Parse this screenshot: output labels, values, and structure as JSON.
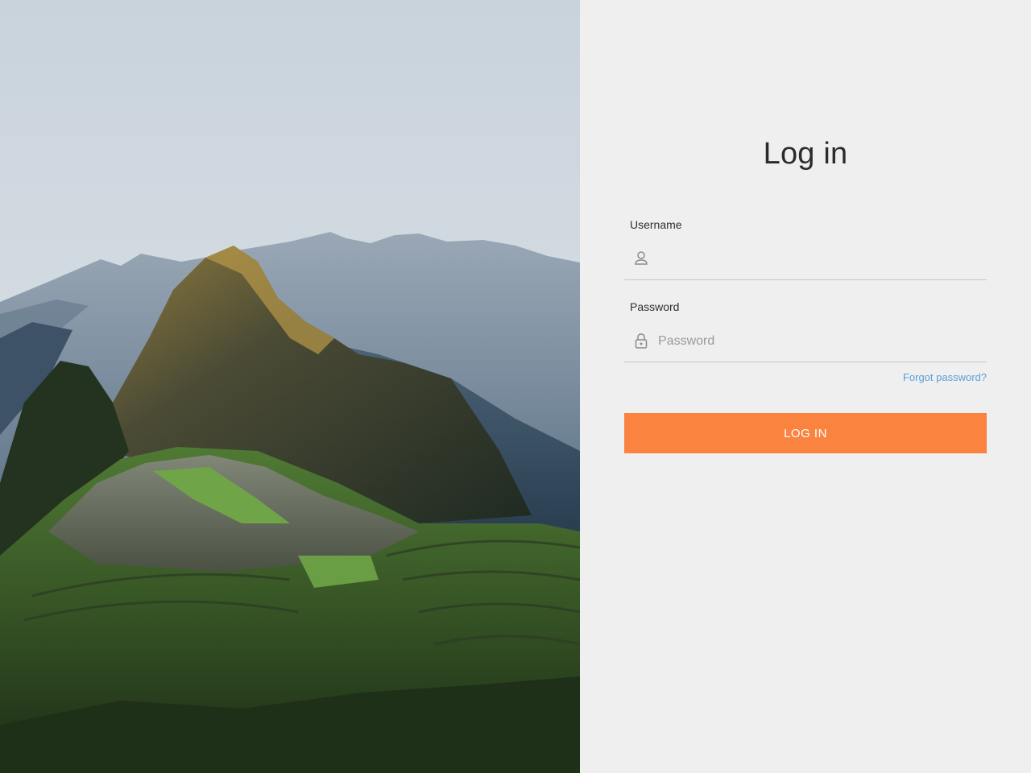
{
  "hero_image": {
    "description_icon": "mountain-landscape-image"
  },
  "login": {
    "title": "Log in",
    "username": {
      "label": "Username",
      "value": "",
      "placeholder": "",
      "icon": "user-icon"
    },
    "password": {
      "label": "Password",
      "value": "",
      "placeholder": "Password",
      "icon": "lock-icon"
    },
    "forgot_password": "Forgot password?",
    "submit_label": "LOG IN"
  },
  "colors": {
    "accent": "#fa8340",
    "link": "#5b9fd6",
    "panel_bg": "#efefef"
  }
}
